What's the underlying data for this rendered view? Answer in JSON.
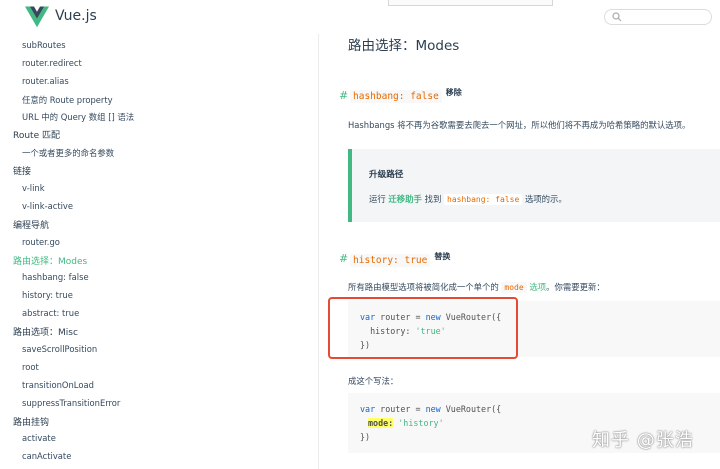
{
  "header": {
    "brand": "Vue.js"
  },
  "sidebar": {
    "items": [
      {
        "label": "subRoutes",
        "level": 1
      },
      {
        "label": "router.redirect",
        "level": 1
      },
      {
        "label": "router.alias",
        "level": 1
      },
      {
        "label": "任意的 Route property",
        "level": 1
      },
      {
        "label": "URL 中的 Query 数组 [] 语法",
        "level": 1
      },
      {
        "label": "Route 匹配",
        "level": 0
      },
      {
        "label": "一个或者更多的命名参数",
        "level": 1
      },
      {
        "label": "链接",
        "level": 0
      },
      {
        "label": "v-link",
        "level": 1
      },
      {
        "label": "v-link-active",
        "level": 1
      },
      {
        "label": "编程导航",
        "level": 0
      },
      {
        "label": "router.go",
        "level": 1
      },
      {
        "label": "路由选择：Modes",
        "level": 0,
        "active": true
      },
      {
        "label": "hashbang: false",
        "level": 1
      },
      {
        "label": "history: true",
        "level": 1
      },
      {
        "label": "abstract: true",
        "level": 1
      },
      {
        "label": "路由选项：Misc",
        "level": 0
      },
      {
        "label": "saveScrollPosition",
        "level": 1
      },
      {
        "label": "root",
        "level": 1
      },
      {
        "label": "transitionOnLoad",
        "level": 1
      },
      {
        "label": "suppressTransitionError",
        "level": 1
      },
      {
        "label": "路由挂钩",
        "level": 0
      },
      {
        "label": "activate",
        "level": 1
      },
      {
        "label": "canActivate",
        "level": 1
      }
    ]
  },
  "main": {
    "title": "路由选择：Modes",
    "section1": {
      "hash": "#",
      "code": "hashbang: false",
      "badge": "移除",
      "text": "Hashbangs 将不再为谷歌需要去爬去一个网址，所以他们将不再成为哈希策略的默认选项。"
    },
    "tip": {
      "title": "升级路径",
      "prefix": "运行",
      "link": "迁移助手",
      "middle": "找到",
      "code": "hashbang: false",
      "suffix": "选项的示。"
    },
    "section2": {
      "hash": "#",
      "code": "history: true",
      "badge": "替换",
      "text_prefix": "所有路由模型选项将被简化成一个单个的",
      "text_code": "mode",
      "text_link": "选项",
      "text_suffix": "。你需要更新："
    },
    "code1": {
      "l1_kw": "var",
      "l1_mid": " router = ",
      "l1_new": "new",
      "l1_end": " VueRouter({",
      "l2_key": "  history: ",
      "l2_val": "'true'",
      "l3": "})"
    },
    "between": "成这个写法：",
    "code2": {
      "l1_kw": "var",
      "l1_mid": " router = ",
      "l1_new": "new",
      "l1_end": " VueRouter({",
      "l2_key": "mode:",
      "l2_val": "'history'",
      "l3": "})"
    },
    "watermark": "知乎 @张浩"
  }
}
